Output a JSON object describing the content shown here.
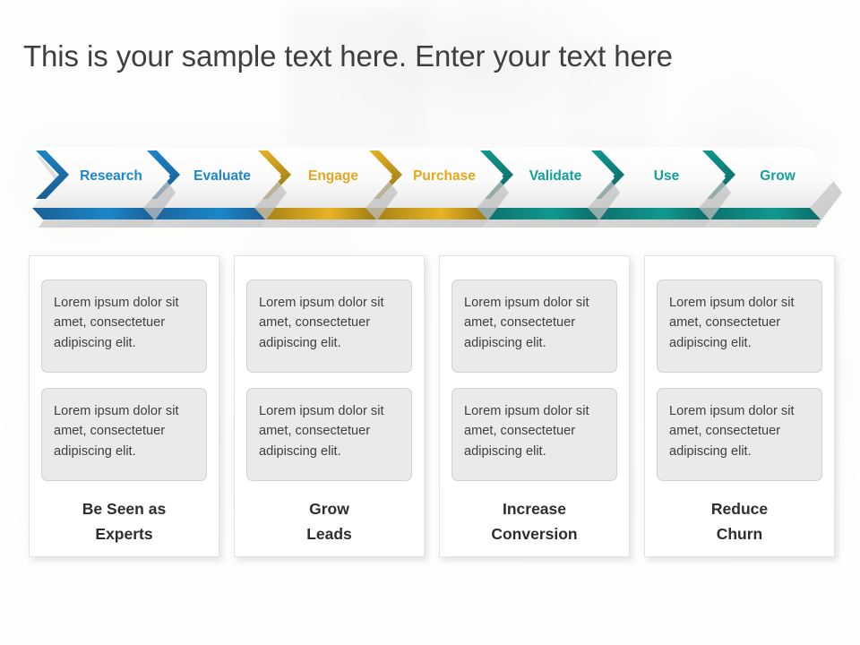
{
  "slide": {
    "headline": "This is your sample text here. Enter your text here",
    "background_description": "faded office conference room photo",
    "headline_color": "#3f3f3f"
  },
  "process": {
    "steps": [
      {
        "label": "Research",
        "color": "#1b87c9",
        "bar_color": "#1b5e96",
        "text_color": "#1b87c9"
      },
      {
        "label": "Evaluate",
        "color": "#1b87c9",
        "bar_color": "#1b5e96",
        "text_color": "#1b87c9"
      },
      {
        "label": "Engage",
        "color": "#e8b325",
        "bar_color": "#9b7a12",
        "text_color": "#e2a81e"
      },
      {
        "label": "Purchase",
        "color": "#e8b325",
        "bar_color": "#9b7a12",
        "text_color": "#e2a81e"
      },
      {
        "label": "Validate",
        "color": "#10998f",
        "bar_color": "#0c6b66",
        "text_color": "#12a098"
      },
      {
        "label": "Use",
        "color": "#10998f",
        "bar_color": "#0c6b66",
        "text_color": "#12a098"
      },
      {
        "label": "Grow",
        "color": "#10998f",
        "bar_color": "#0c6b66",
        "text_color": "#12a098"
      }
    ]
  },
  "cards": [
    {
      "title_line1": "Be Seen as",
      "title_line2": "Experts",
      "bullets": [
        "Lorem ipsum dolor sit amet, consectetuer adipiscing elit.",
        "Lorem ipsum dolor sit amet, consectetuer adipiscing elit."
      ]
    },
    {
      "title_line1": "Grow",
      "title_line2": "Leads",
      "bullets": [
        "Lorem ipsum dolor sit amet, consectetuer adipiscing elit.",
        "Lorem ipsum dolor sit amet, consectetuer adipiscing elit."
      ]
    },
    {
      "title_line1": "Increase",
      "title_line2": "Conversion",
      "bullets": [
        "Lorem ipsum dolor sit amet, consectetuer adipiscing elit.",
        "Lorem ipsum dolor sit amet, consectetuer adipiscing elit."
      ]
    },
    {
      "title_line1": "Reduce",
      "title_line2": "Churn",
      "bullets": [
        "Lorem ipsum dolor sit amet, consectetuer adipiscing elit.",
        "Lorem ipsum dolor sit amet, consectetuer adipiscing elit."
      ]
    }
  ]
}
